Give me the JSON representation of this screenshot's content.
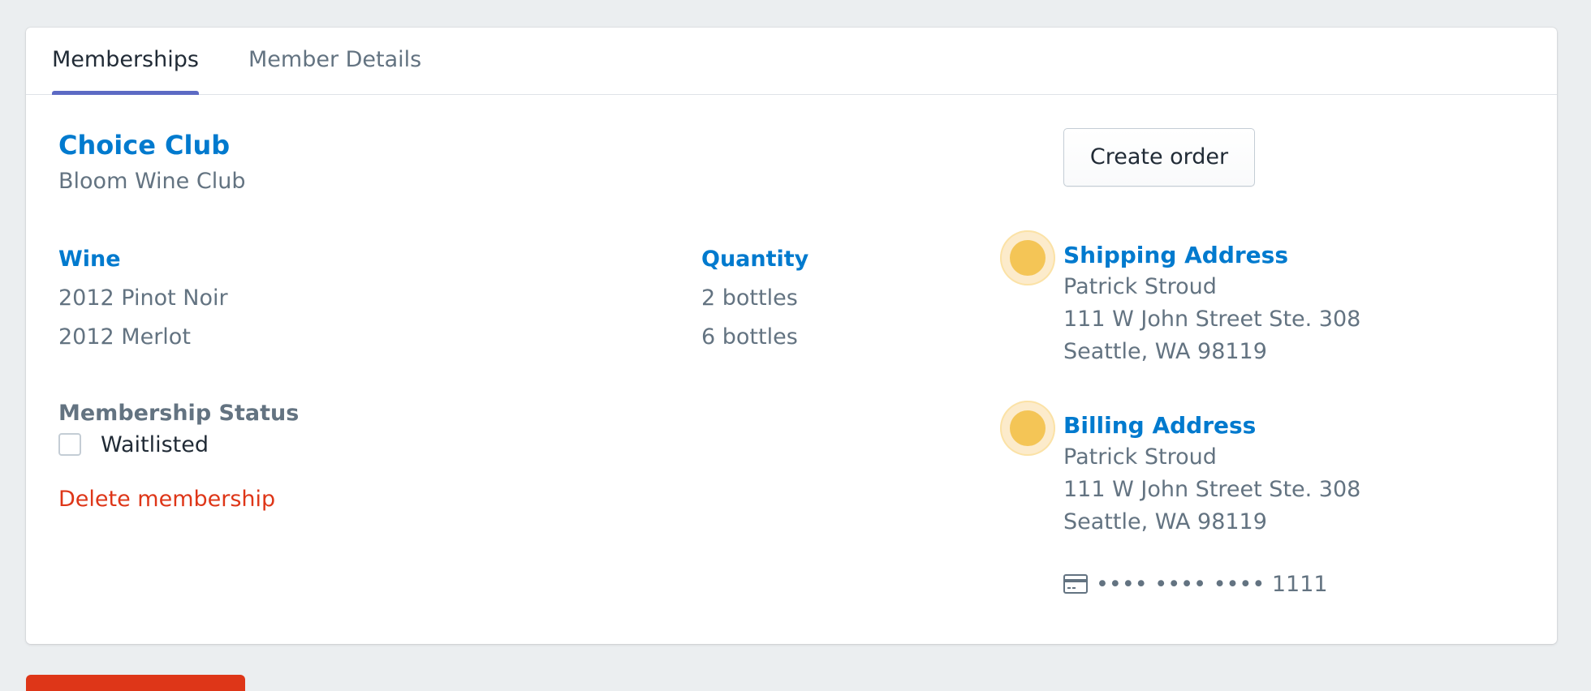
{
  "tabs": [
    {
      "label": "Memberships",
      "active": true
    },
    {
      "label": "Member Details",
      "active": false
    }
  ],
  "club": {
    "title": "Choice Club",
    "subtitle": "Bloom Wine Club"
  },
  "wine_table": {
    "headers": {
      "wine": "Wine",
      "quantity": "Quantity"
    },
    "rows": [
      {
        "wine": "2012 Pinot Noir",
        "quantity": "2 bottles"
      },
      {
        "wine": "2012 Merlot",
        "quantity": "6 bottles"
      }
    ]
  },
  "membership_status": {
    "label": "Membership Status",
    "option_label": "Waitlisted",
    "checked": false
  },
  "actions": {
    "delete_label": "Delete membership",
    "create_order_label": "Create order"
  },
  "shipping": {
    "heading": "Shipping Address",
    "name": "Patrick Stroud",
    "street": "111 W John Street Ste. 308",
    "city": "Seattle, WA 98119"
  },
  "billing": {
    "heading": "Billing Address",
    "name": "Patrick Stroud",
    "street": "111 W John Street Ste. 308",
    "city": "Seattle, WA 98119",
    "card_number": "•••• •••• •••• 1111"
  },
  "icons": {
    "address_marker": "status-dot-icon",
    "payment": "credit-card-icon"
  },
  "colors": {
    "accent": "#007ace",
    "tab_indicator": "#5c6ac4",
    "destructive": "#de3618",
    "marker": "#f4c556"
  }
}
